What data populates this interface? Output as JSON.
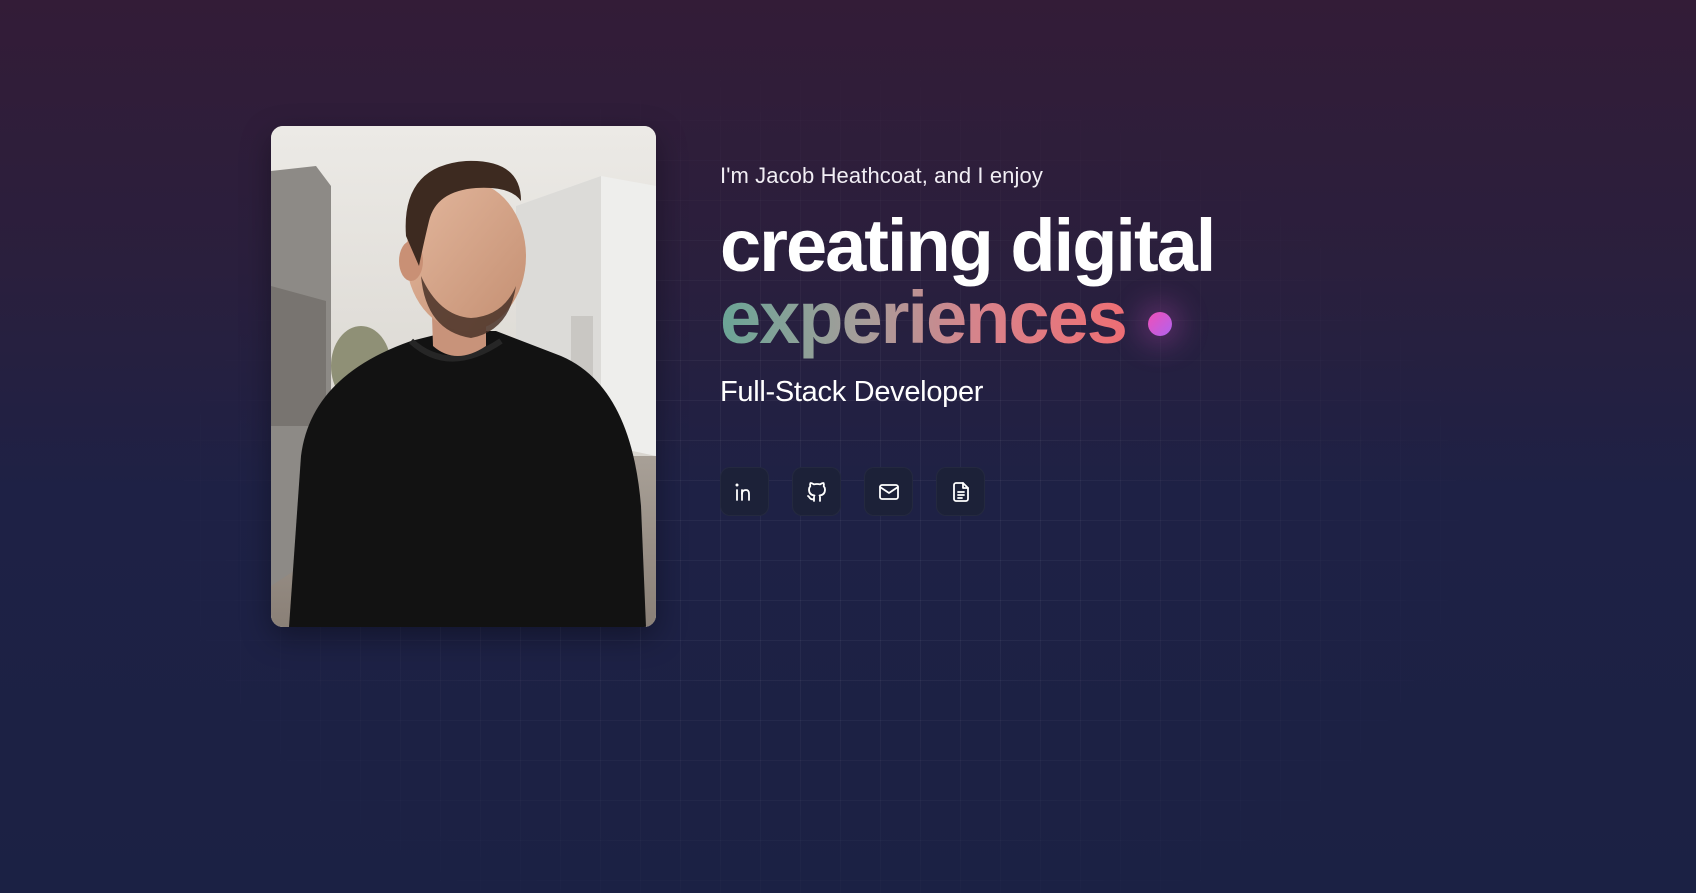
{
  "intro": "I'm Jacob Heathcoat, and I enjoy",
  "headline": {
    "line1": "creating digital",
    "line2": "experiences"
  },
  "role": "Full-Stack Developer",
  "portrait": {
    "subject": "Photo of Jacob Heathcoat"
  },
  "socials": [
    {
      "name": "LinkedIn",
      "icon": "linkedin-icon"
    },
    {
      "name": "GitHub",
      "icon": "github-icon"
    },
    {
      "name": "Email",
      "icon": "mail-icon"
    },
    {
      "name": "Resume",
      "icon": "document-icon"
    }
  ],
  "colors": {
    "background_top": "#331c37",
    "background_bottom": "#1b2144",
    "gradient_start": "#6aa596",
    "gradient_end": "#ee6f74",
    "accent_dot": "#e351c4"
  }
}
